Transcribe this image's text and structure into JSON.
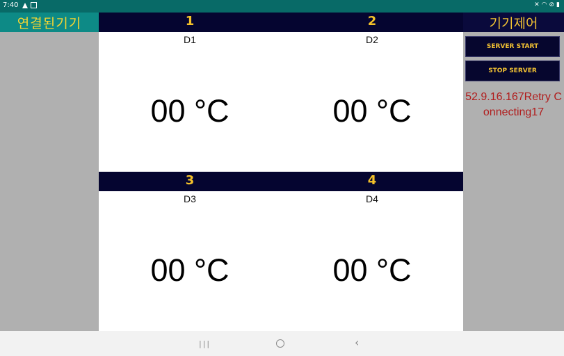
{
  "status_bar": {
    "time": "7:40"
  },
  "left_panel": {
    "title": "연결된기기"
  },
  "right_panel": {
    "title": "기기제어",
    "server_start_label": "SERVER START",
    "stop_server_label": "STOP SERVER",
    "status_message": "52.9.16.167Retry Connecting17"
  },
  "devices": [
    {
      "number": "1",
      "name": "D1",
      "temperature": "00 °C"
    },
    {
      "number": "2",
      "name": "D2",
      "temperature": "00 °C"
    },
    {
      "number": "3",
      "name": "D3",
      "temperature": "00 °C"
    },
    {
      "number": "4",
      "name": "D4",
      "temperature": "00 °C"
    }
  ],
  "colors": {
    "header_bg": "#050530",
    "accent_yellow": "#f4c12a",
    "sidebar_teal": "#0d8a86",
    "status_red": "#b11d1d"
  }
}
